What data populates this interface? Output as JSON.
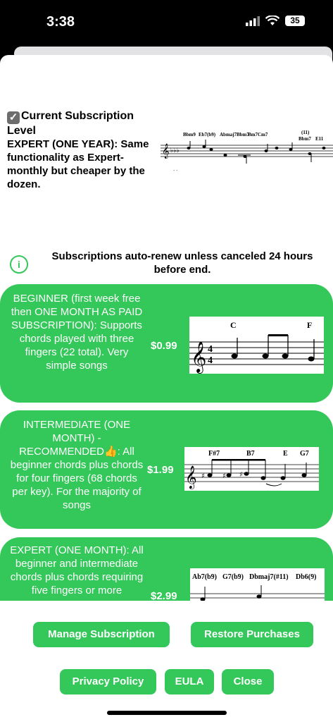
{
  "status": {
    "time": "3:38",
    "battery": "35"
  },
  "current": {
    "title": "Current Subscription Level",
    "text": "EXPERT (ONE YEAR):  Same functionality as Expert-monthly but cheaper by the dozen."
  },
  "notice": "Subscriptions auto-renew unless canceled 24 hours before end.",
  "plans": [
    {
      "description": "BEGINNER (first week free then ONE MONTH AS PAID SUBSCRIPTION): Supports chords played with three fingers (22 total). Very simple songs",
      "price": "$0.99",
      "chords": [
        "C",
        "F"
      ]
    },
    {
      "description": "INTERMEDIATE (ONE MONTH) - RECOMMENDED👍: All beginner chords plus chords for four fingers (68 chords per key). For the majority of songs",
      "price": "$1.99",
      "chords": [
        "F#7",
        "B7",
        "E",
        "G7"
      ]
    },
    {
      "description": "EXPERT (ONE MONTH): All beginner and intermediate chords plus chords requiring five fingers or more",
      "price": "$2.99",
      "chords": [
        "Ab7(b9)",
        "G7(b9)",
        "Dbmaj7(#11)",
        "Db6(9)"
      ]
    }
  ],
  "header_chords": [
    "Bbm9",
    "Eb7(b9)",
    "Abmaj7",
    "Bbm7",
    "Bm7",
    "Cm7",
    "(11)",
    "Bbm7",
    "E11"
  ],
  "buttons": {
    "manage": "Manage Subscription",
    "restore": "Restore Purchases",
    "privacy": "Privacy Policy",
    "eula": "EULA",
    "close": "Close"
  }
}
